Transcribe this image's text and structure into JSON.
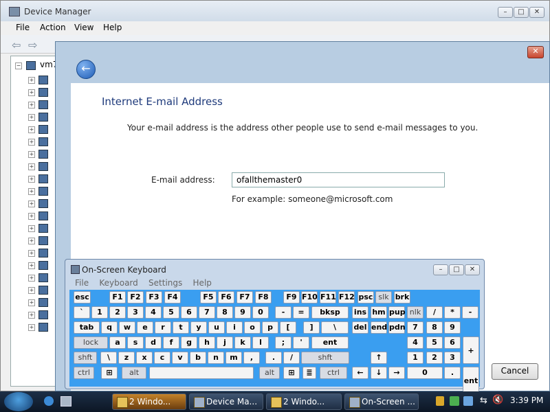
{
  "device_manager": {
    "title": "Device Manager",
    "menu": [
      "File",
      "Action",
      "View",
      "Help"
    ],
    "tree_root": "vm7"
  },
  "wizard": {
    "heading": "Internet E-mail Address",
    "description": "Your e-mail address is the address other people use to send e-mail messages to you.",
    "email_label": "E-mail address:",
    "email_value": "ofallthemaster0",
    "example": "For example: someone@microsoft.com",
    "cancel_label": "Cancel"
  },
  "osk": {
    "title": "On-Screen Keyboard",
    "menu": [
      "File",
      "Keyboard",
      "Settings",
      "Help"
    ]
  },
  "taskbar": {
    "buttons": [
      "2 Windo...",
      "Device Ma...",
      "2 Windo...",
      "On-Screen ..."
    ],
    "clock": "3:39 PM"
  },
  "colors": {
    "keyboard_bg": "#3a9ef0",
    "heading": "#1e3a7b",
    "taskbar": "#0c1624"
  }
}
